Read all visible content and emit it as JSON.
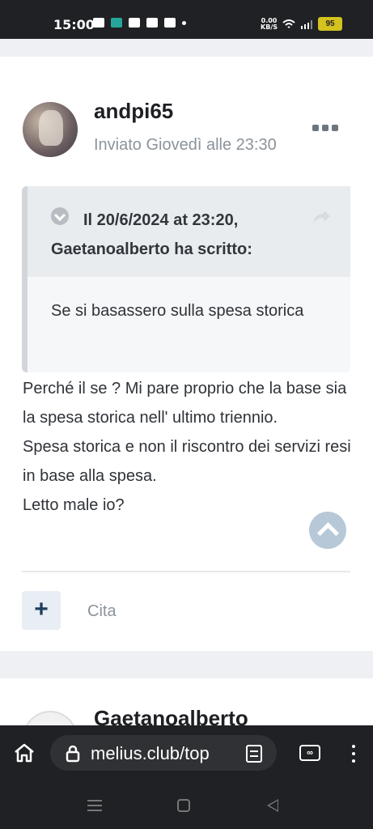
{
  "status_bar": {
    "time": "15:00",
    "network_speed": "0.00\nKB/S",
    "battery": "95"
  },
  "post": {
    "author": "andpi65",
    "posted": "Inviato Giovedì alle 23:30",
    "quote": {
      "header": "Il 20/6/2024 at 23:20, Gaetanoalberto ha scritto:",
      "body": "Se si basassero sulla spesa storica"
    },
    "lines": [
      "Perché il se ? Mi pare proprio che la base  sia la spesa storica nell' ultimo triennio.",
      "Spesa storica  e non il riscontro dei servizi resi in base alla spesa.",
      "Letto male io?"
    ],
    "actions": {
      "plus": "+",
      "quote": "Cita"
    }
  },
  "next_post": {
    "author": "Gaetanoalberto"
  },
  "browser": {
    "url": "melius.club/top",
    "tabs_label": "∞"
  }
}
